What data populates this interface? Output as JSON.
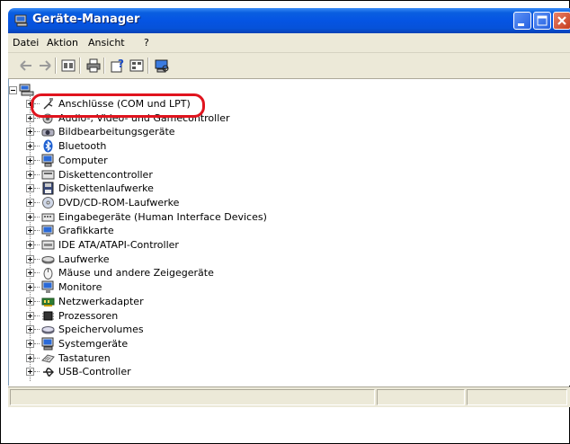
{
  "window": {
    "title": "Geräte-Manager",
    "accent": "#0554e3",
    "close_color": "#c53d1c"
  },
  "menu": [
    "Datei",
    "Aktion",
    "Ansicht",
    "?"
  ],
  "toolbar": [
    "back-arrow-icon",
    "forward-arrow-icon",
    "properties-icon",
    "print-icon",
    "help-icon",
    "view-icon",
    "scan-hardware-icon"
  ],
  "tree": {
    "root": "",
    "items": [
      "Anschlüsse (COM und LPT)",
      "Audio-, Video- und Gamecontroller",
      "Bildbearbeitungsgeräte",
      "Bluetooth",
      "Computer",
      "Diskettencontroller",
      "Diskettenlaufwerke",
      "DVD/CD-ROM-Laufwerke",
      "Eingabegeräte (Human Interface Devices)",
      "Grafikkarte",
      "IDE ATA/ATAPI-Controller",
      "Laufwerke",
      "Mäuse und andere Zeigegeräte",
      "Monitore",
      "Netzwerkadapter",
      "Prozessoren",
      "Speichervolumes",
      "Systemgeräte",
      "Tastaturen",
      "USB-Controller"
    ],
    "icons": [
      "port-icon",
      "audio-icon",
      "camera-icon",
      "bluetooth-icon",
      "computer-icon",
      "floppy-controller-icon",
      "floppy-drive-icon",
      "dvd-drive-icon",
      "input-device-icon",
      "display-adapter-icon",
      "ide-controller-icon",
      "drive-icon",
      "mouse-icon",
      "monitor-icon",
      "network-adapter-icon",
      "processor-icon",
      "storage-volume-icon",
      "system-device-icon",
      "keyboard-icon",
      "usb-icon"
    ]
  },
  "annotation": {
    "highlight_color": "#e0141e"
  }
}
